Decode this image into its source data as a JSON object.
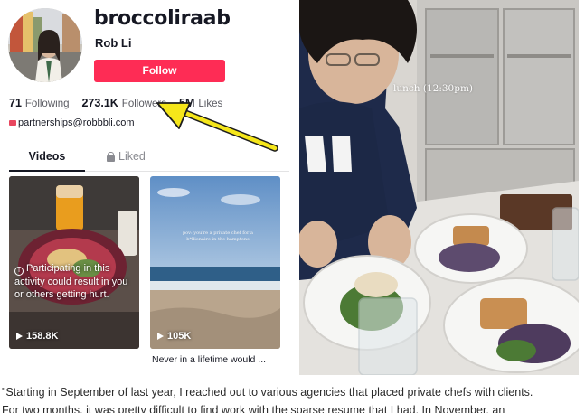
{
  "profile": {
    "username": "broccoliraab",
    "display_name": "Rob Li",
    "follow_label": "Follow",
    "stats": {
      "following_count": "71",
      "following_label": "Following",
      "followers_count": "273.1K",
      "followers_label": "Followers",
      "likes_count": "5M",
      "likes_label": "Likes"
    },
    "bio_email": "partnerships@robbbli.com"
  },
  "tabs": {
    "videos": "Videos",
    "liked": "Liked"
  },
  "videos": [
    {
      "warning_text": "Participating in this activity could result in you or others getting hurt.",
      "views": "158.8K"
    },
    {
      "overlay_text": "pov: you're a private chef for a b*llionaire in the hamptons",
      "views": "105K",
      "caption": "Never in a lifetime would ..."
    }
  ],
  "photo": {
    "label": "lunch (12:30pm)"
  },
  "article": {
    "line1": "\"Starting in September of last year, I reached out to various agencies that placed private chefs with clients.",
    "line2": "For two months, it was pretty difficult to find work with the sparse resume that I had. In November, an"
  },
  "colors": {
    "follow_button": "#fe2c55",
    "annotation_arrow": "#f5e61a",
    "text_primary": "#161823",
    "text_secondary": "#5a5b62"
  }
}
